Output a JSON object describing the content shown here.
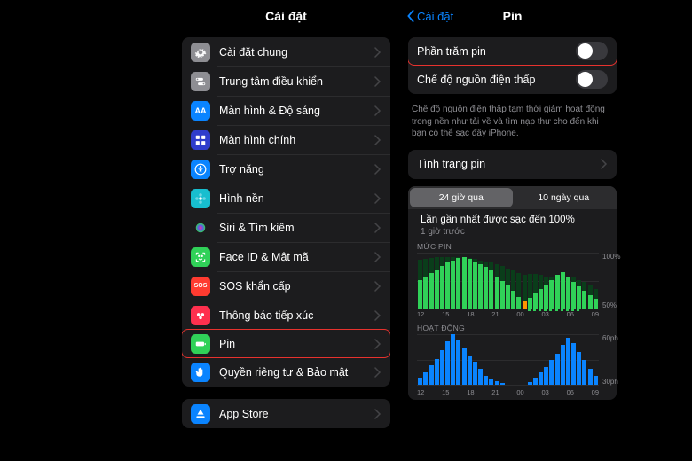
{
  "left": {
    "title": "Cài đặt",
    "items": [
      {
        "label": "Cài đặt chung",
        "icon": "gear",
        "bg": "#8e8e93"
      },
      {
        "label": "Trung tâm điều khiển",
        "icon": "switches",
        "bg": "#8e8e93"
      },
      {
        "label": "Màn hình & Độ sáng",
        "icon": "AA",
        "bg": "#0a84ff",
        "text": true
      },
      {
        "label": "Màn hình chính",
        "icon": "grid",
        "bg": "#2f3dcc"
      },
      {
        "label": "Trợ năng",
        "icon": "access",
        "bg": "#0a84ff"
      },
      {
        "label": "Hình nền",
        "icon": "flower",
        "bg": "#17becf"
      },
      {
        "label": "Siri & Tìm kiếm",
        "icon": "siri",
        "bg": "#1c1c1e"
      },
      {
        "label": "Face ID & Mật mã",
        "icon": "face",
        "bg": "#30d158"
      },
      {
        "label": "SOS khẩn cấp",
        "icon": "SOS",
        "bg": "#ff3b30",
        "text": true
      },
      {
        "label": "Thông báo tiếp xúc",
        "icon": "exposure",
        "bg": "#ff304e"
      },
      {
        "label": "Pin",
        "icon": "battery",
        "bg": "#30d158",
        "hi": true
      },
      {
        "label": "Quyền riêng tư & Bảo mật",
        "icon": "hand",
        "bg": "#0a84ff"
      }
    ],
    "items2": [
      {
        "label": "App Store",
        "icon": "appstore",
        "bg": "#0a84ff"
      }
    ]
  },
  "right": {
    "back": "Cài đặt",
    "title": "Pin",
    "toggles": [
      {
        "label": "Phần trăm pin",
        "on": false,
        "hi": true
      },
      {
        "label": "Chế độ nguồn điện thấp",
        "on": false
      }
    ],
    "footer": "Chế độ nguồn điện thấp tạm thời giảm hoạt động trong nền như tải về và tìm nạp thư cho đến khi bạn có thể sạc đầy iPhone.",
    "health": "Tình trạng pin",
    "seg": [
      "24 giờ qua",
      "10 ngày qua"
    ],
    "seg_active": 0,
    "last_charge": "Lần gần nhất được sạc đến 100%",
    "last_charge_sub": "1 giờ trước",
    "level_title": "MỨC PIN",
    "activity_title": "HOẠT ĐỘNG"
  },
  "chart_data": [
    {
      "type": "bar",
      "title": "MỨC PIN",
      "ylabel": "%",
      "ylim": [
        0,
        100
      ],
      "yticks": [
        "100%",
        "50%"
      ],
      "x": [
        "12",
        "15",
        "18",
        "21",
        "00",
        "03",
        "06",
        "09"
      ],
      "series": [
        {
          "name": "active",
          "color": "#30d158",
          "values": [
            50,
            55,
            62,
            68,
            74,
            80,
            84,
            88,
            90,
            86,
            82,
            78,
            72,
            66,
            56,
            48,
            40,
            30,
            20,
            12,
            18,
            28,
            34,
            42,
            50,
            58,
            64,
            55,
            46,
            38,
            30,
            22,
            16
          ]
        },
        {
          "name": "background",
          "color": "#0a3d1a",
          "values": [
            85,
            86,
            88,
            90,
            90,
            90,
            90,
            90,
            90,
            88,
            86,
            84,
            82,
            80,
            78,
            74,
            70,
            66,
            62,
            58,
            60,
            60,
            58,
            56,
            54,
            56,
            58,
            56,
            54,
            50,
            46,
            40,
            34
          ]
        }
      ]
    },
    {
      "type": "bar",
      "title": "HOẠT ĐỘNG",
      "ylabel": "ph",
      "ylim": [
        0,
        60
      ],
      "yticks": [
        "60ph",
        "30ph"
      ],
      "x": [
        "12",
        "15",
        "18",
        "21",
        "00",
        "03",
        "06",
        "09"
      ],
      "series": [
        {
          "name": "screen-on",
          "color": "#0a84ff",
          "values": [
            8,
            14,
            22,
            30,
            40,
            50,
            58,
            52,
            42,
            34,
            26,
            18,
            10,
            6,
            4,
            2,
            0,
            0,
            0,
            0,
            3,
            8,
            14,
            20,
            28,
            36,
            46,
            54,
            48,
            38,
            28,
            18,
            10
          ]
        },
        {
          "name": "screen-off",
          "color": "#083057",
          "values": [
            2,
            3,
            4,
            5,
            6,
            7,
            8,
            7,
            6,
            5,
            4,
            3,
            2,
            1,
            1,
            1,
            0,
            0,
            0,
            0,
            1,
            2,
            3,
            4,
            5,
            6,
            7,
            8,
            7,
            6,
            5,
            4,
            3
          ]
        }
      ]
    }
  ]
}
